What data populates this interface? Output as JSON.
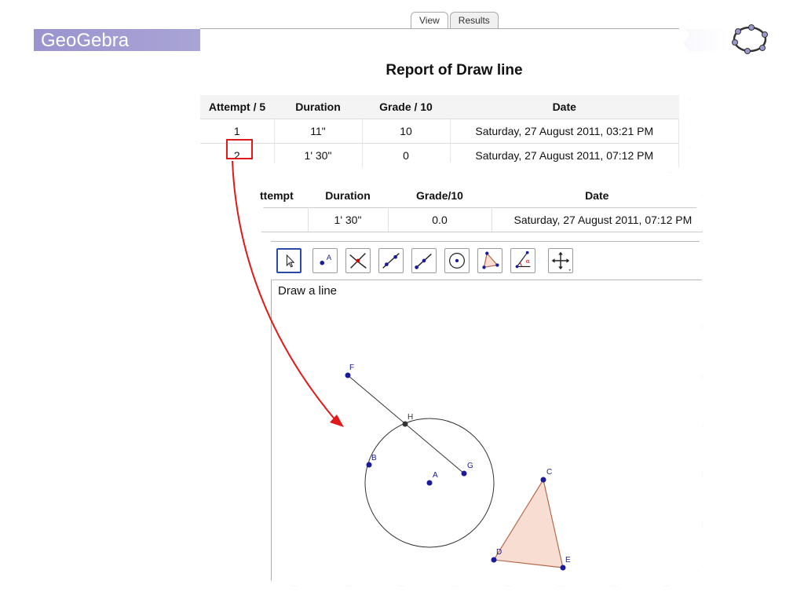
{
  "brand": {
    "title": "GeoGebra"
  },
  "report": {
    "tabs": [
      {
        "label": "View"
      },
      {
        "label": "Results"
      }
    ],
    "title": "Report of Draw line",
    "headers": [
      "Attempt / 5",
      "Duration",
      "Grade / 10",
      "Date"
    ],
    "rows": [
      {
        "attempt": "1",
        "duration": "11\"",
        "grade": "10",
        "date": "Saturday, 27 August 2011, 03:21 PM"
      },
      {
        "attempt": "2",
        "duration": "1' 30\"",
        "grade": "0",
        "date": "Saturday, 27 August 2011, 07:12 PM"
      }
    ]
  },
  "detail": {
    "headers": [
      "ttempt",
      "Duration",
      "Grade/10",
      "Date"
    ],
    "row": {
      "attempt": "",
      "duration": "1' 30\"",
      "grade": "0.0",
      "date": "Saturday, 27 August 2011, 07:12 PM"
    },
    "toolbar": [
      "move-tool-icon",
      "point-tool-icon",
      "intersect-tool-icon",
      "line-tool-icon",
      "segment-tool-icon",
      "circle-tool-icon",
      "polygon-tool-icon",
      "angle-tool-icon",
      "move-graphics-view-icon"
    ],
    "prompt": "Draw a line",
    "points": {
      "F": "F",
      "H": "H",
      "B": "B",
      "A": "A",
      "G": "G",
      "C": "C",
      "D": "D",
      "E": "E"
    }
  },
  "colors": {
    "band": "#9a94cf",
    "highlight": "#e01919",
    "point": "#1a1a9c",
    "polygon_fill": "#f7ddd2",
    "polygon_stroke": "#b5694a"
  }
}
